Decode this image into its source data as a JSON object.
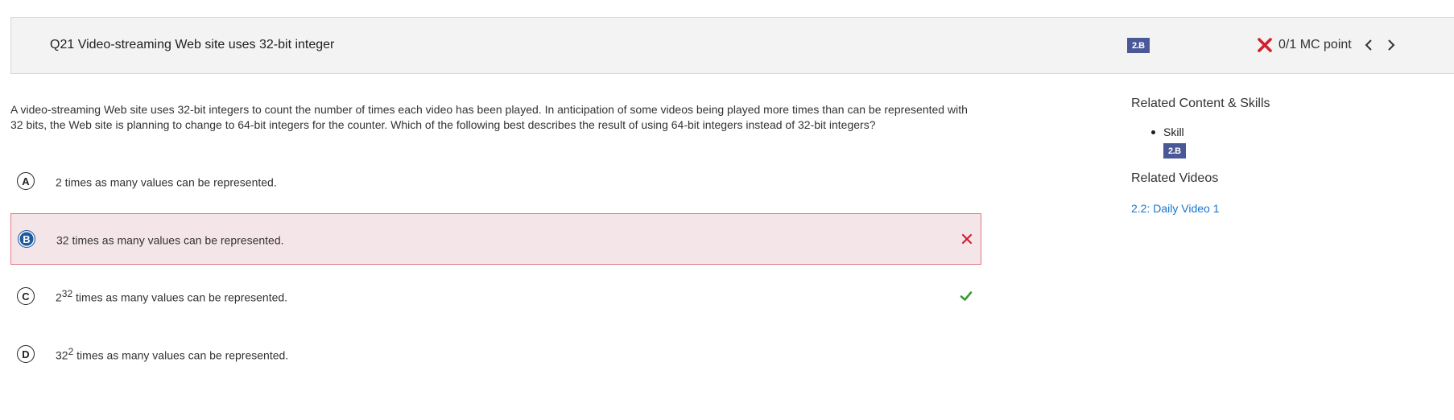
{
  "question": {
    "title": "Q21 Video-streaming Web site uses 32-bit integer",
    "skill_badge": "2.B",
    "score": "0/1 MC point",
    "stem": "A video-streaming Web site uses 32-bit integers to count the number of times each video has been played. In anticipation of some videos being played more times than can be represented with 32 bits, the Web site is planning to change to 64-bit integers for the counter. Which of the following best describes the result of using 64-bit integers instead of 32-bit integers?"
  },
  "options": [
    {
      "letter": "A",
      "base": "",
      "exp": "",
      "text": "2 times as many values can be represented.",
      "state": "none"
    },
    {
      "letter": "B",
      "base": "",
      "exp": "",
      "text": "32 times as many values can be represented.",
      "state": "incorrect-selected"
    },
    {
      "letter": "C",
      "base": "2",
      "exp": "32",
      "text": " times as many values can be represented.",
      "state": "correct"
    },
    {
      "letter": "D",
      "base": "32",
      "exp": "2",
      "text": " times as many values can be represented.",
      "state": "none"
    }
  ],
  "sidebar": {
    "related_heading": "Related Content & Skills",
    "skill_label": "Skill",
    "skill_badge": "2.B",
    "videos_heading": "Related Videos",
    "video_link": "2.2: Daily Video 1"
  },
  "colors": {
    "incorrect": "#d11f2e",
    "correct": "#3a9a3a",
    "badge": "#4a5898",
    "link": "#1a73c9"
  }
}
